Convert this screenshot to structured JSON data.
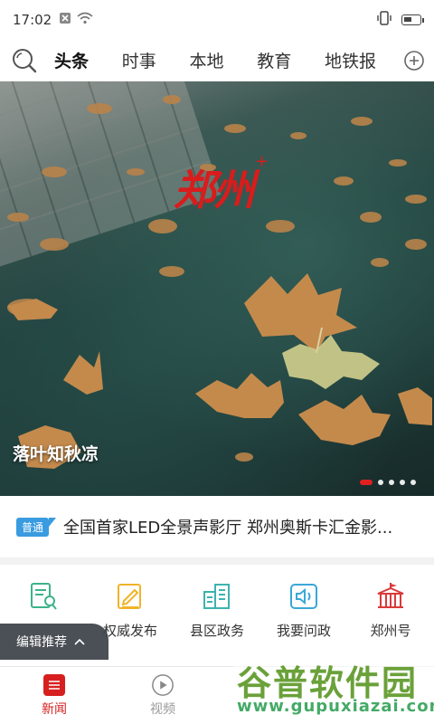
{
  "status_bar": {
    "time": "17:02",
    "icons": [
      "close-box-icon",
      "wifi-icon"
    ],
    "right_icons": [
      "vibrate-icon",
      "battery-icon"
    ]
  },
  "tabs": {
    "items": [
      {
        "label": "头条",
        "active": true
      },
      {
        "label": "时事",
        "active": false
      },
      {
        "label": "本地",
        "active": false
      },
      {
        "label": "教育",
        "active": false
      },
      {
        "label": "地铁报",
        "active": false
      }
    ]
  },
  "hero": {
    "logo_text": "郑州",
    "logo_sup": "+",
    "caption": "落叶知秋凉",
    "slides_count": 5,
    "active_slide": 1
  },
  "ticker": {
    "badge": "普通",
    "text": "全国首家LED全景声影厅 郑州奥斯卡汇金影..."
  },
  "quick_links": [
    {
      "label": "",
      "icon": "microphone-edit-icon",
      "color": "#3cb38a"
    },
    {
      "label": "权威发布",
      "icon": "edit-doc-icon",
      "color": "#f0b429"
    },
    {
      "label": "县区政务",
      "icon": "buildings-icon",
      "color": "#3cb3b0"
    },
    {
      "label": "我要问政",
      "icon": "speaker-icon",
      "color": "#3aa7d8"
    },
    {
      "label": "郑州号",
      "icon": "pavilion-icon",
      "color": "#d93a3a"
    }
  ],
  "editor_recommend": {
    "label": "编辑推荐"
  },
  "bottom_nav": [
    {
      "label": "新闻",
      "icon": "news-icon",
      "active": true
    },
    {
      "label": "视频",
      "icon": "video-icon",
      "active": false
    }
  ],
  "watermark": {
    "title": "谷普软件园",
    "url": "www.gupuxiazai.com"
  },
  "colors": {
    "brand_red": "#d71f1f",
    "badge_blue": "#3a9be0"
  }
}
